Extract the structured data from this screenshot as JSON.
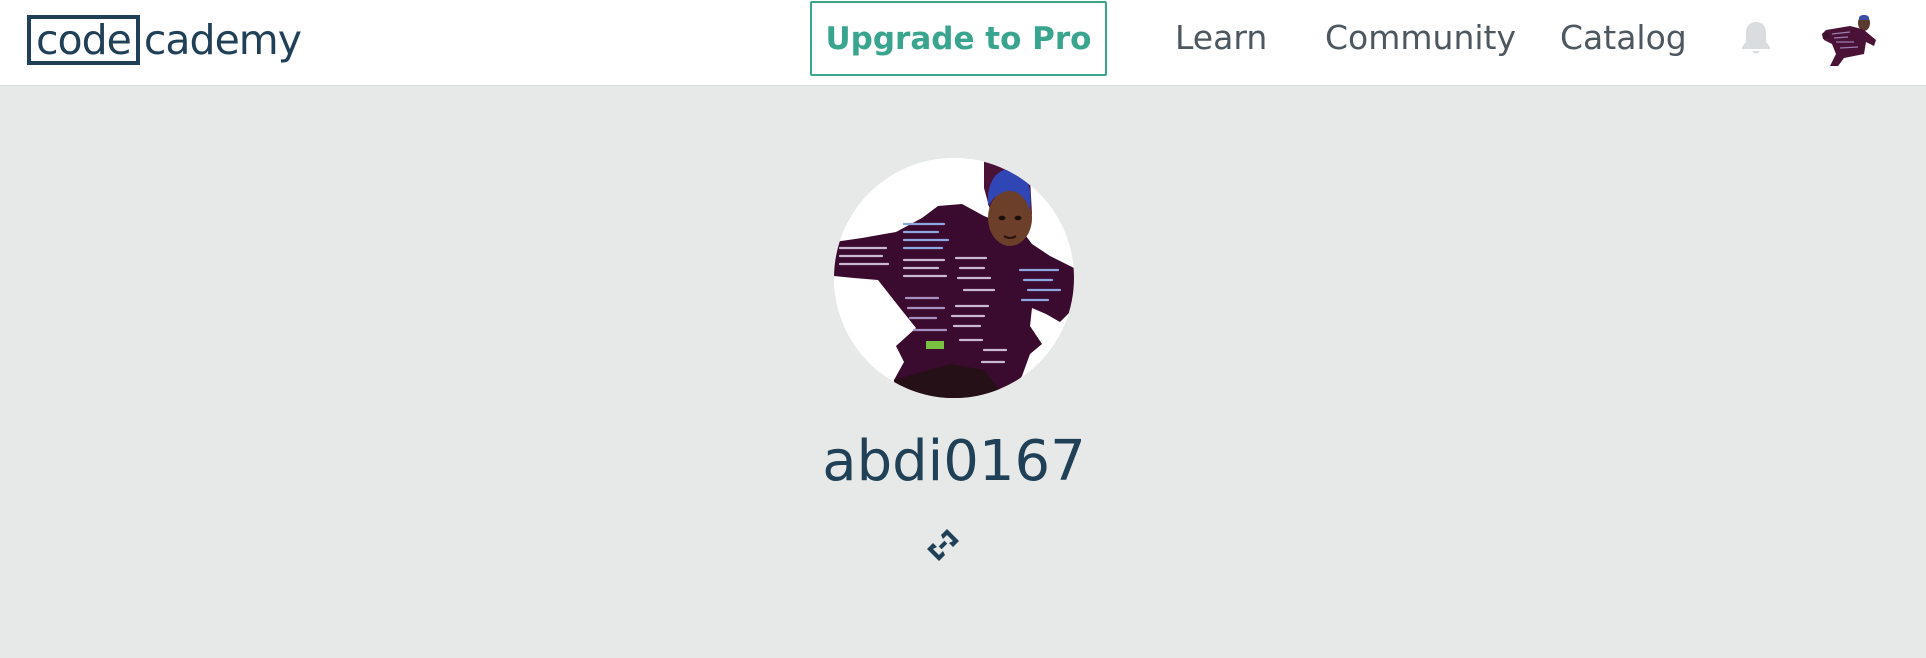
{
  "header": {
    "logo": {
      "boxed_text": "code",
      "rest_text": "cademy"
    },
    "upgrade_label": "Upgrade to Pro",
    "nav": [
      {
        "label": "Learn"
      },
      {
        "label": "Community"
      },
      {
        "label": "Catalog"
      }
    ],
    "icons": {
      "notifications": "bell-icon",
      "account": "user-avatar"
    }
  },
  "profile": {
    "username": "abdi0167",
    "icons": {
      "link": "link-icon"
    }
  },
  "colors": {
    "brand_navy": "#1f4056",
    "accent_green": "#3aa58f",
    "page_background": "#e7e9e8",
    "header_background": "#ffffff"
  }
}
